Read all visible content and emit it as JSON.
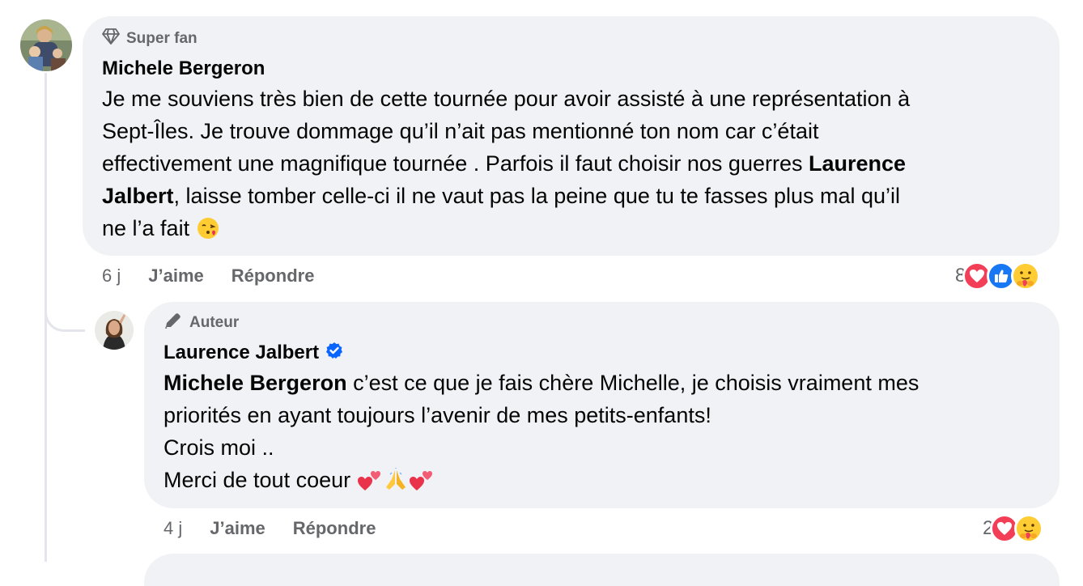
{
  "comment1": {
    "badge": "Super fan",
    "author": "Michele Bergeron",
    "lines": [
      "Je me souviens très bien de cette tournée pour avoir assisté à une représentation à",
      "Sept-Îles. Je trouve dommage qu’il n’ait pas mentionné ton nom car c’était",
      "effectivement une magnifique tournée . Parfois il faut choisir nos guerres "
    ],
    "mention_part1": "Laurence",
    "mention_part2": "Jalbert",
    "line4_rest": ", laisse tomber celle-ci il ne vaut pas la peine que tu te fasses plus mal qu’il",
    "line5": "ne l’a fait ",
    "emoji": "face-blowing-kiss",
    "time": "6 j",
    "like_label": "J’aime",
    "reply_label": "Répondre",
    "reaction_count": "8",
    "reaction_icons": [
      "love-reaction",
      "like-reaction",
      "care-reaction"
    ]
  },
  "comment2": {
    "badge": "Auteur",
    "author": "Laurence Jalbert",
    "verified": true,
    "mention": "Michele Bergeron",
    "line1_rest": " c’est ce que je fais chère Michelle, je choisis vraiment mes",
    "line2": "priorités en ayant toujours l’avenir de mes petits-enfants!",
    "line3": "Crois moi ..",
    "line4": "Merci de tout coeur ",
    "emojis": [
      "two-hearts",
      "folded-hands",
      "two-hearts"
    ],
    "time": "4 j",
    "like_label": "J’aime",
    "reply_label": "Répondre",
    "reaction_count": "2",
    "reaction_icons": [
      "love-reaction",
      "care-reaction"
    ]
  },
  "colors": {
    "bubble": "#f0f2f5",
    "muted": "#65676b",
    "verified": "#0866ff",
    "love": "#f33e58",
    "like": "#1877f2"
  }
}
